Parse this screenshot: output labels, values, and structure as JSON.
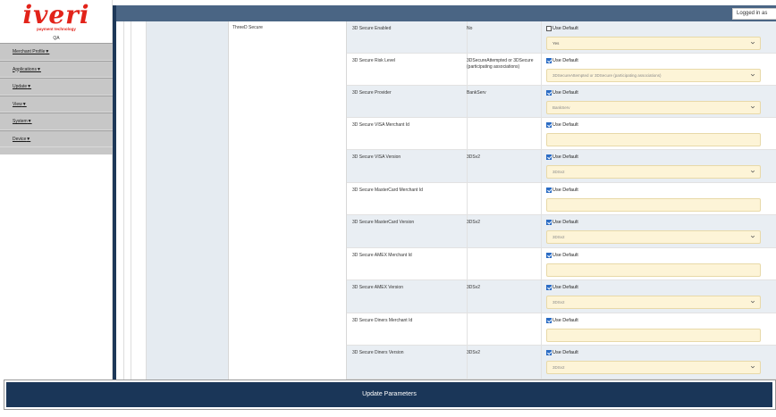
{
  "logo": {
    "brand": "iveri",
    "tagline": "payment technology"
  },
  "sidebar": {
    "user": "QA",
    "items": [
      {
        "label": "Merchant Profile"
      },
      {
        "label": "Applications"
      },
      {
        "label": "Update"
      },
      {
        "label": "View"
      },
      {
        "label": "System"
      },
      {
        "label": "Device"
      }
    ]
  },
  "header": {
    "login_text": "Logged in as"
  },
  "group_label": "ThreeD Secure",
  "rows": [
    {
      "name": "3D Secure Enabled",
      "value": "No",
      "use_default_label": "Use Default",
      "use_default": false,
      "control": "select",
      "control_value": "Yes",
      "dim": false
    },
    {
      "name": "3D Secure Risk Level",
      "value": "3DSecureAttempted or 3DSecure (participating associations)",
      "use_default_label": "Use Default",
      "use_default": true,
      "control": "select",
      "control_value": "3DSecureAttempted or 3DSecure (participating associations)",
      "dim": true
    },
    {
      "name": "3D Secure Provider",
      "value": "BankServ",
      "use_default_label": "Use Default",
      "use_default": true,
      "control": "select",
      "control_value": "BankServ",
      "dim": true
    },
    {
      "name": "3D Secure VISA Merchant Id",
      "value": "",
      "use_default_label": "Use Default",
      "use_default": true,
      "control": "input",
      "control_value": "",
      "dim": true
    },
    {
      "name": "3D Secure VISA Version",
      "value": "3DSv2",
      "use_default_label": "Use Default",
      "use_default": true,
      "control": "select",
      "control_value": "3DSv2",
      "dim": true
    },
    {
      "name": "3D Secure MasterCard Merchant Id",
      "value": "",
      "use_default_label": "Use Default",
      "use_default": true,
      "control": "input",
      "control_value": "",
      "dim": true
    },
    {
      "name": "3D Secure MasterCard Version",
      "value": "3DSv2",
      "use_default_label": "Use Default",
      "use_default": true,
      "control": "select",
      "control_value": "3DSv2",
      "dim": true
    },
    {
      "name": "3D Secure AMEX Merchant Id",
      "value": "",
      "use_default_label": "Use Default",
      "use_default": true,
      "control": "input",
      "control_value": "",
      "dim": true
    },
    {
      "name": "3D Secure AMEX Version",
      "value": "3DSv2",
      "use_default_label": "Use Default",
      "use_default": true,
      "control": "select",
      "control_value": "3DSv2",
      "dim": true
    },
    {
      "name": "3D Secure Diners Merchant Id",
      "value": "",
      "use_default_label": "Use Default",
      "use_default": true,
      "control": "input",
      "control_value": "",
      "dim": true
    },
    {
      "name": "3D Secure Diners Version",
      "value": "3DSv2",
      "use_default_label": "Use Default",
      "use_default": true,
      "control": "select",
      "control_value": "3DSv2",
      "dim": true
    }
  ],
  "footer": {
    "update_label": "Update Parameters"
  },
  "colors": {
    "accent": "#1a3658",
    "header": "#4a6584",
    "brand": "#e2231a",
    "field_bg": "#fdf4d7"
  }
}
